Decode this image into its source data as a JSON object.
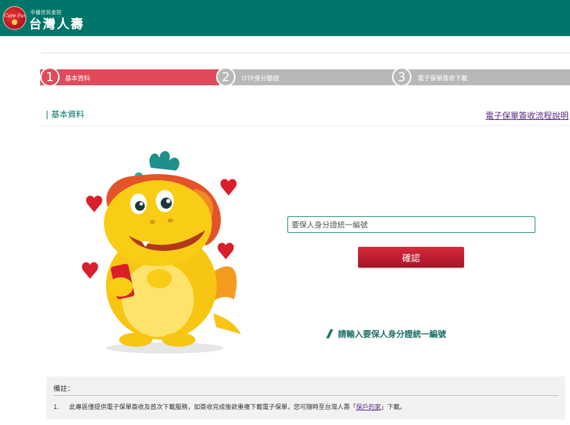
{
  "header": {
    "logo_script": "We Care Family",
    "logo_sub": "中國信託金控",
    "logo_main": "台灣人壽",
    "bg_color": "#00766a"
  },
  "steps": [
    {
      "number": "1",
      "label": "基本資料",
      "active": true
    },
    {
      "number": "2",
      "label": "OTP身分驗證",
      "active": false
    },
    {
      "number": "3",
      "label": "電子保單簽收下載",
      "active": false
    }
  ],
  "section": {
    "title": "| 基本資料",
    "guide_link": "電子保單簽收流程說明"
  },
  "form": {
    "title": "請輸入要保人身分證統一編號",
    "input_placeholder": "要保人身分證統一編號",
    "input_value": "",
    "confirm_label": "確認"
  },
  "notes": {
    "title": "備註：",
    "items": [
      {
        "number": "1.",
        "text_before": "此專區僅提供電子保單簽收及首次下載服務，如簽收完成後欲重複下載電子保單，您可隨時至台灣人壽「",
        "link": "保戶的家",
        "text_after": "」下載。"
      }
    ]
  },
  "colors": {
    "active_step": "#e14a5c",
    "inactive_step": "#b8b8b8",
    "accent_teal": "#00766a",
    "button_red": "#c41f33",
    "link_purple": "#5a2a82"
  },
  "icons": {
    "logo": "company-logo-icon",
    "mascot": "dragon-mascot-illustration",
    "title_marker": "slash-marker-icon"
  }
}
